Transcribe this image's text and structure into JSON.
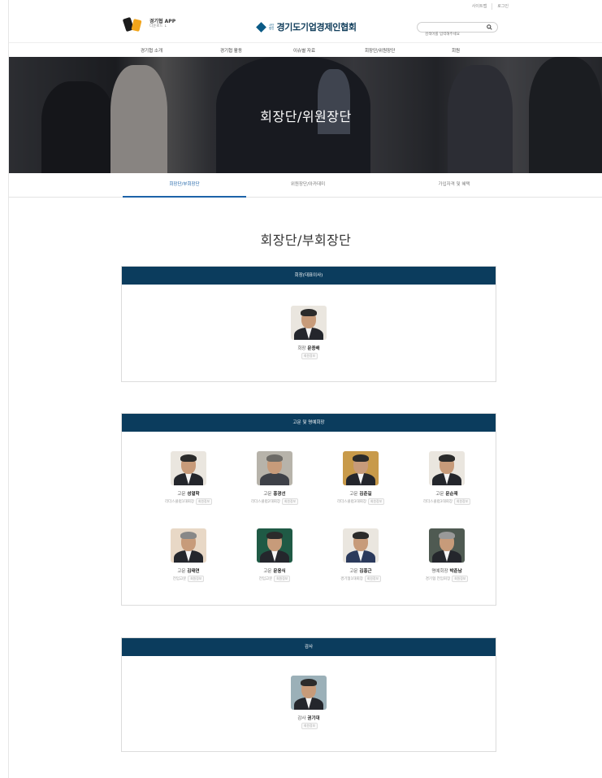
{
  "utility": {
    "links": [
      "사이트맵",
      "로그인"
    ]
  },
  "header": {
    "app_title": "경기협 APP",
    "app_sub": "다운로드 ↓",
    "logo_mini_1": "사단",
    "logo_mini_2": "법인",
    "logo_name": "경기도기업경제인협회",
    "search_placeholder": "검색어를 입력해주세요"
  },
  "nav": {
    "items": [
      "경기협 소개",
      "경기협 활동",
      "이슈별 자료",
      "회장단/위원장단",
      "회원"
    ]
  },
  "hero": {
    "title": "회장단/위원장단"
  },
  "tabs": {
    "items": [
      "회장단/부회장단",
      "위원장단/아카데미",
      "가입자격 및 혜택"
    ],
    "active": 0
  },
  "section_title": "회장단/부회장단",
  "groups": [
    {
      "title": "회장(대표이사)",
      "members": [
        {
          "role": "회장",
          "name": "문종배",
          "org": "",
          "badge": "회원정보"
        }
      ]
    },
    {
      "title": "고문 및 명예회장",
      "members": [
        {
          "role": "고문",
          "name": "성열학",
          "org": "리더스클럽1대회장",
          "badge": "회원정보"
        },
        {
          "role": "고문",
          "name": "홍광선",
          "org": "리더스클럽2대회장",
          "badge": "회원정보"
        },
        {
          "role": "고문",
          "name": "김춘길",
          "org": "리더스클럽3대회장",
          "badge": "회원정보"
        },
        {
          "role": "고문",
          "name": "문순재",
          "org": "리더스클럽3대회장",
          "badge": "회원정보"
        },
        {
          "role": "고문",
          "name": "김태연",
          "org": "전임고문",
          "badge": "회원정보"
        },
        {
          "role": "고문",
          "name": "문웅식",
          "org": "전임고문",
          "badge": "회원정보"
        },
        {
          "role": "고문",
          "name": "김홍근",
          "org": "경기협1대회장",
          "badge": "회원정보"
        },
        {
          "role": "명예회장",
          "name": "박춘남",
          "org": "경기협 전임회장",
          "badge": "회원정보"
        }
      ]
    },
    {
      "title": "감사",
      "members": [
        {
          "role": "감사",
          "name": "권기대",
          "org": "",
          "badge": "회원정보"
        }
      ]
    }
  ],
  "colors": {
    "bar": "#0b3c5d",
    "accent": "#1d63a8"
  }
}
